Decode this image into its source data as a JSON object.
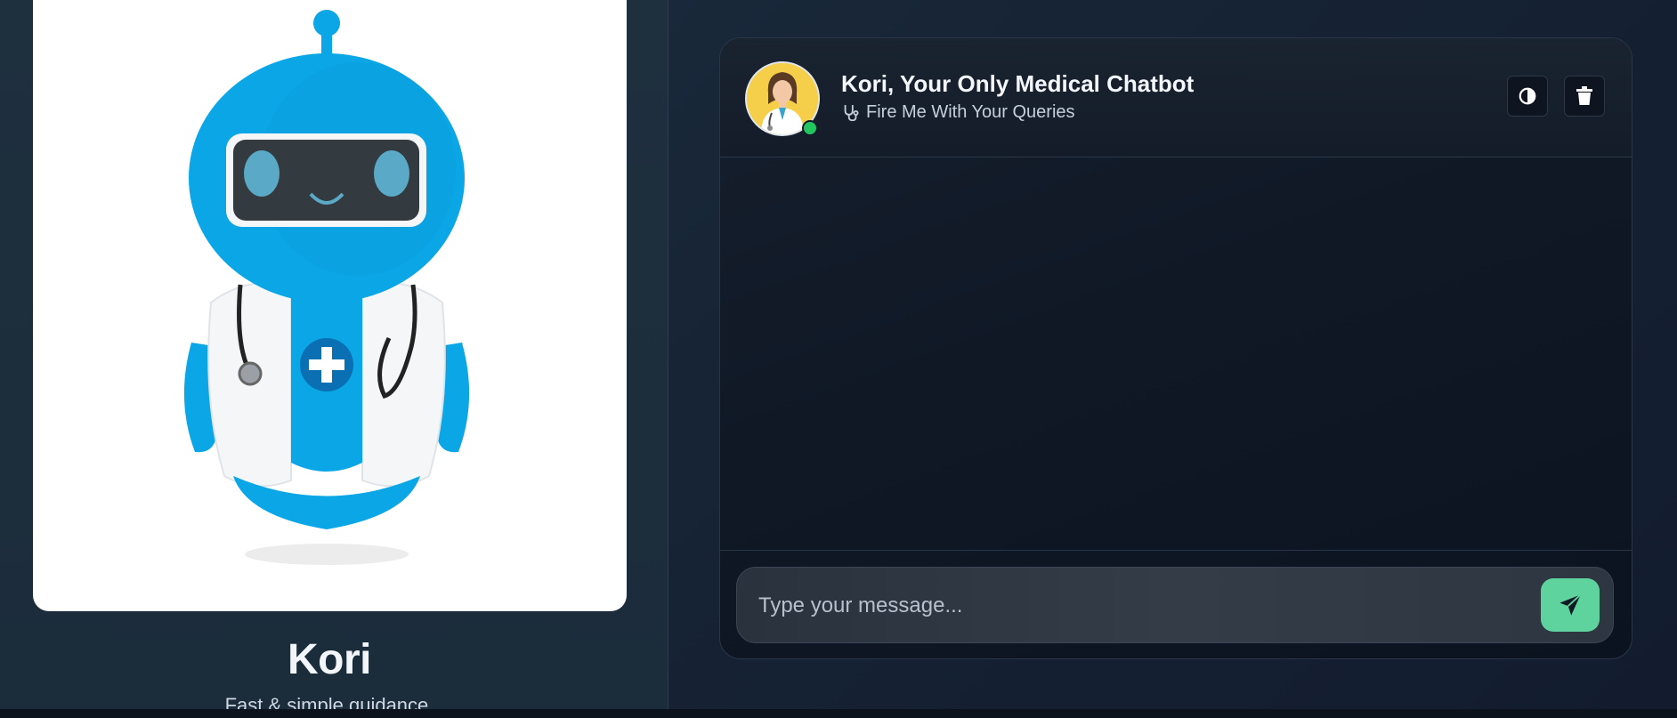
{
  "sidebar": {
    "bot_name": "Kori",
    "tagline": "Fast & simple guidance.",
    "hero_image": "robot-doctor-illustration"
  },
  "chat": {
    "title": "Kori, Your Only Medical Chatbot",
    "subtitle": "Fire Me With Your Queries",
    "subtitle_icon": "stethoscope-icon",
    "avatar": "doctor-avatar",
    "status": "online",
    "actions": {
      "theme_icon": "contrast-icon",
      "clear_icon": "trash-icon"
    },
    "input": {
      "placeholder": "Type your message...",
      "value": ""
    },
    "send_icon": "paper-plane-icon"
  },
  "colors": {
    "accent": "#5fd39d",
    "robot_blue": "#0aa6e6",
    "avatar_bg": "#f6cf4a",
    "online": "#22c55e"
  }
}
